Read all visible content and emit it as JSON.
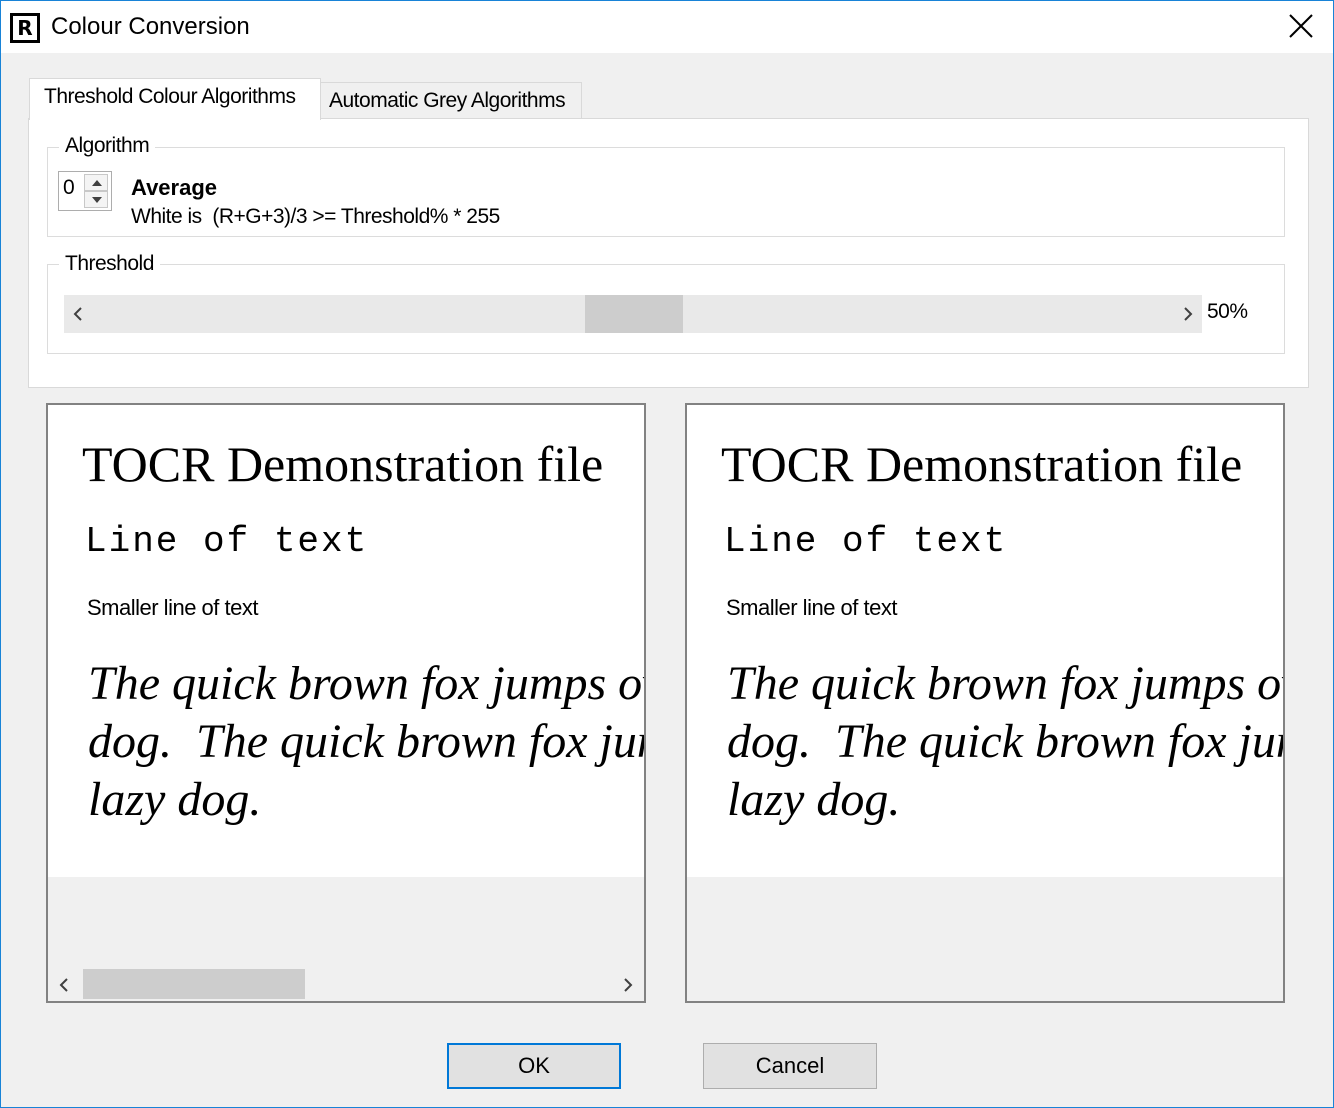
{
  "window": {
    "title": "Colour Conversion",
    "icon_letter": "R"
  },
  "tabs": [
    {
      "label": "Threshold Colour Algorithms",
      "active": true
    },
    {
      "label": "Automatic Grey Algorithms",
      "active": false
    }
  ],
  "algorithm": {
    "group_label": "Algorithm",
    "spinner_value": "0",
    "name": "Average",
    "formula": "White is  (R+G+3)/3 >= Threshold% * 255"
  },
  "threshold": {
    "group_label": "Threshold",
    "value_label": "50%",
    "value_fraction": 0.5
  },
  "preview": {
    "title": "TOCR Demonstration file",
    "mono_line": "Line of text",
    "small_line": "Smaller line of text",
    "italic_text": "The quick brown fox jumps over the lazy\ndog.  The quick brown fox jumps over the\nlazy dog."
  },
  "buttons": {
    "ok_label": "OK",
    "cancel_label": "Cancel"
  },
  "colors": {
    "accent": "#0078d7",
    "window_border": "#1883d7",
    "face": "#f0f0f0"
  }
}
